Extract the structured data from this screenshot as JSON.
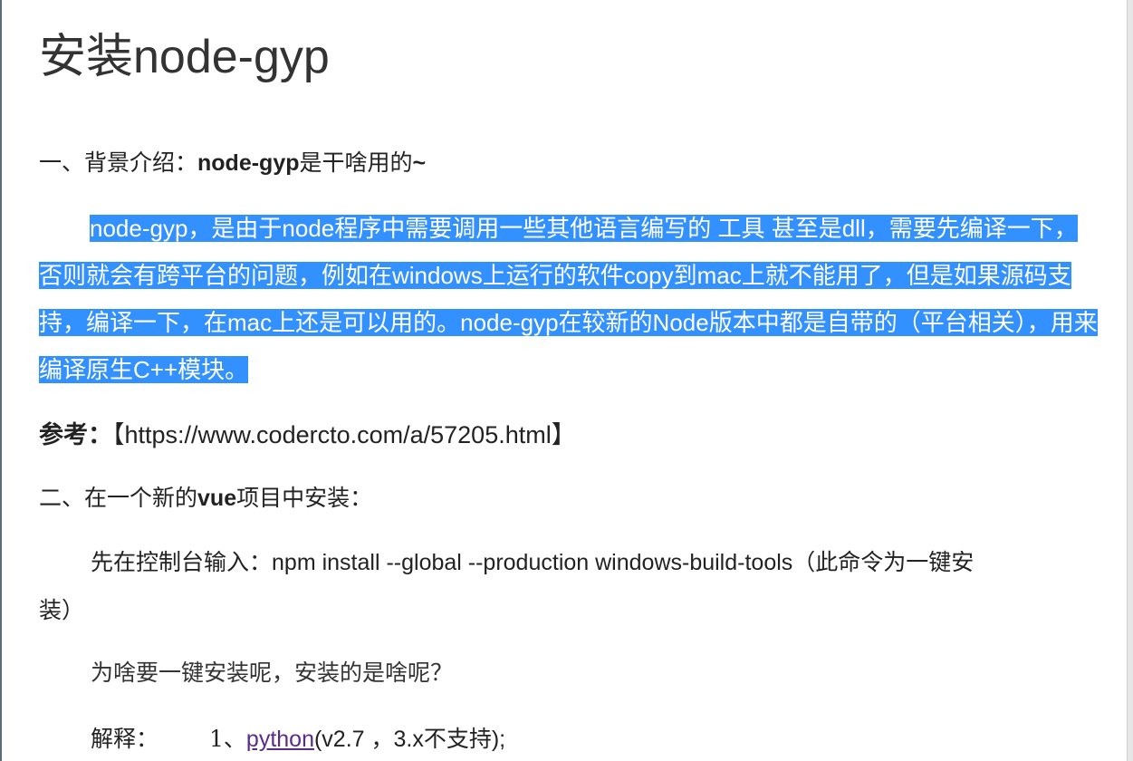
{
  "title": "安装node-gyp",
  "section1": {
    "prefix": "一、背景介绍：",
    "bold": "node-gyp",
    "suffix": "是干啥用的",
    "tilde": "~"
  },
  "paragraph": "node-gyp，是由于node程序中需要调用一些其他语言编写的 工具 甚至是dll，需要先编译一下，否则就会有跨平台的问题，例如在windows上运行的软件copy到mac上就不能用了，但是如果源码支持，编译一下，在mac上还是可以用的。node-gyp在较新的Node版本中都是自带的（平台相关），用来编译原生C++模块。",
  "reference": {
    "label": "参考：",
    "text": "【https://www.codercto.com/a/57205.html】"
  },
  "section2": {
    "prefix": "二、在一个新的",
    "bold": "vue",
    "suffix": "项目中安装："
  },
  "command": {
    "prefix": "先在控制台输入：",
    "code": "npm install --global --production windows-build-tools",
    "note_line1": "（此命令为一键安",
    "note_line2": "装）"
  },
  "question": "为啥要一键安装呢，安装的是啥呢？",
  "explain": {
    "label": "解释：",
    "item_prefix": "1、",
    "link": "python",
    "item_suffix": "(v2.7 ，3.x不支持);"
  },
  "colors": {
    "selection": "#3390ff",
    "link": "#5b2b8c",
    "text": "#222222"
  }
}
